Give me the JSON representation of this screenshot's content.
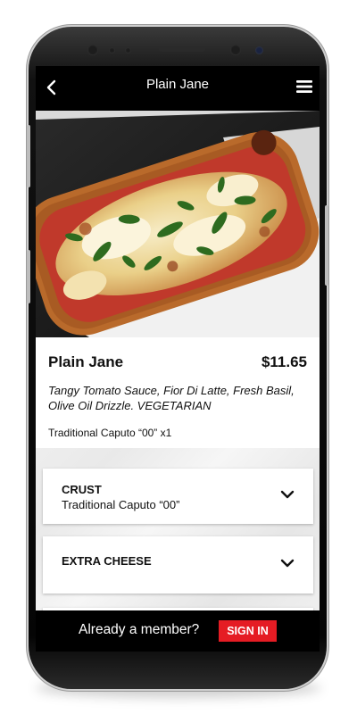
{
  "header": {
    "title": "Plain Jane",
    "back_icon": "chevron-left-icon",
    "menu_icon": "hamburger-menu-icon"
  },
  "product": {
    "name": "Plain Jane",
    "price": "$11.65",
    "description": "Tangy Tomato Sauce, Fior Di Latte, Fresh Basil, Olive Oil Drizzle. VEGETARIAN",
    "selection": "Traditional Caputo “00” x1"
  },
  "options": [
    {
      "title": "CRUST",
      "value": "Traditional Caputo “00”",
      "icon": "chevron-down-icon"
    },
    {
      "title": "EXTRA CHEESE",
      "value": "",
      "icon": "chevron-down-icon"
    }
  ],
  "footer": {
    "member_text": "Already a member?",
    "signin_label": "SIGN IN"
  },
  "colors": {
    "accent": "#e51c24",
    "bar": "#000000"
  }
}
